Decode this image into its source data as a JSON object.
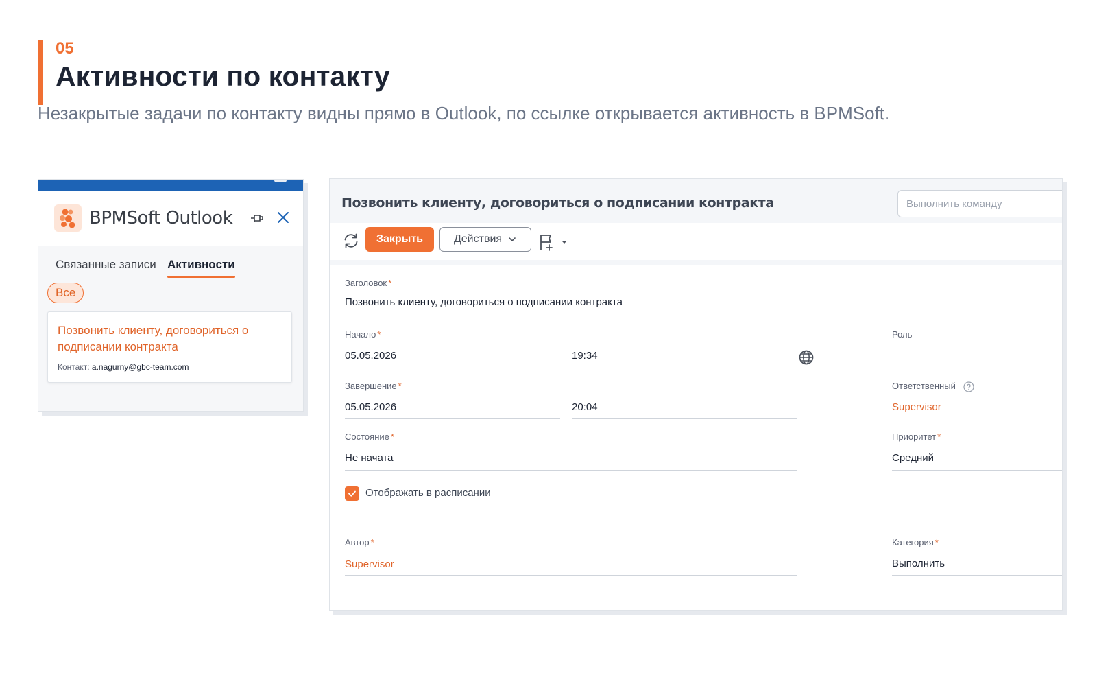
{
  "slide": {
    "number": "05",
    "title": "Активности по контакту",
    "subtitle": "Незакрытые задачи по контакту видны прямо в Outlook, по ссылке открывается активность в BPMSoft."
  },
  "outlook_panel": {
    "app_name": "BPMSoft Outlook",
    "icons": {
      "logo": "bpmsoft-logo-icon",
      "pin": "pin-icon",
      "close": "close-icon"
    },
    "tabs": [
      {
        "label": "Связанные записи",
        "active": false
      },
      {
        "label": "Активности",
        "active": true
      }
    ],
    "filter_chip": "Все",
    "activity": {
      "title": "Позвонить клиенту, договориться о подписании контракта",
      "contact_label": "Контакт:",
      "contact_value": "a.nagurny@gbc-team.com"
    }
  },
  "bpm_page": {
    "title": "Позвонить клиенту, договориться о подписании контракта",
    "command_placeholder": "Выполнить команду",
    "toolbar": {
      "refresh_icon": "refresh-icon",
      "close_label": "Закрыть",
      "actions_label": "Действия",
      "flag_icon": "flag-add-icon"
    },
    "fields": {
      "subject": {
        "label": "Заголовок",
        "value": "Позвонить клиенту, договориться о подписании контракта"
      },
      "start": {
        "label": "Начало",
        "date": "05.05.2026",
        "time": "19:34"
      },
      "end": {
        "label": "Завершение",
        "date": "05.05.2026",
        "time": "20:04"
      },
      "status": {
        "label": "Состояние",
        "value": "Не начата"
      },
      "role": {
        "label": "Роль",
        "value": ""
      },
      "owner": {
        "label": "Ответственный",
        "value": "Supervisor"
      },
      "priority": {
        "label": "Приоритет",
        "value": "Средний"
      },
      "show_in_schedule": {
        "label": "Отображать в расписании",
        "checked": true
      },
      "author": {
        "label": "Автор",
        "value": "Supervisor"
      },
      "category": {
        "label": "Категория",
        "value": "Выполнить"
      }
    }
  },
  "colors": {
    "accent": "#f07033",
    "link": "#e0642a",
    "outlook_blue": "#1d63b5",
    "title_dark": "#1d2433",
    "subtitle_gray": "#6b7587"
  }
}
